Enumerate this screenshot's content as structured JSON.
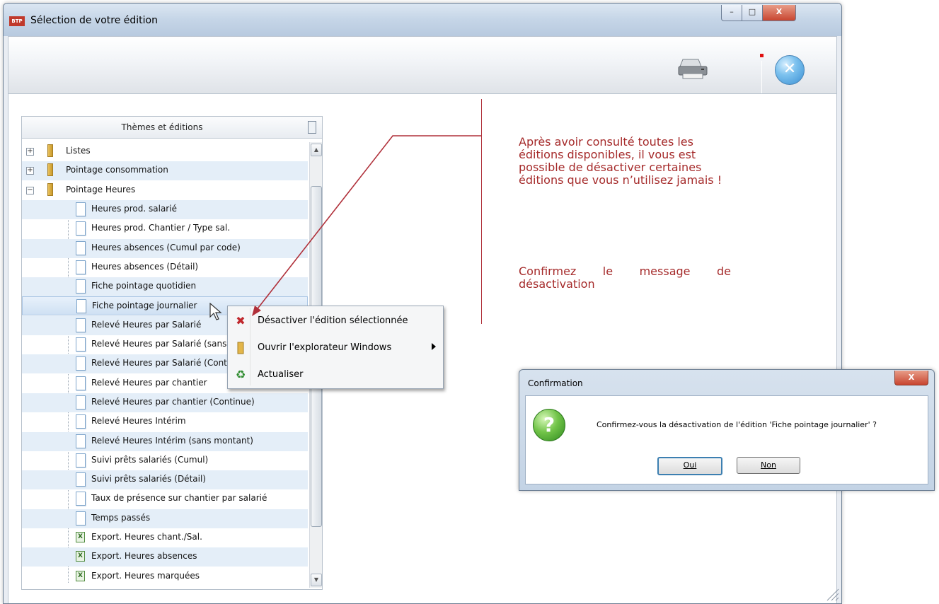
{
  "window": {
    "title": "Sélection de votre édition",
    "logo_text": "BTP",
    "controls": {
      "minimize": "–",
      "maximize": "□",
      "close": "X"
    }
  },
  "toolbar": {
    "print_icon": "printer-icon",
    "exit_icon": "exit-icon",
    "exit_glyph": "✕"
  },
  "tree": {
    "header": "Thèmes et éditions",
    "rows": [
      {
        "label": "Listes",
        "type": "folder",
        "expander": "+"
      },
      {
        "label": "Pointage consommation",
        "type": "folder",
        "expander": "+"
      },
      {
        "label": "Pointage Heures",
        "type": "folder",
        "expander": "−"
      },
      {
        "label": "Heures prod. salarié",
        "type": "doc"
      },
      {
        "label": "Heures prod. Chantier / Type sal.",
        "type": "doc"
      },
      {
        "label": "Heures absences (Cumul par code)",
        "type": "doc"
      },
      {
        "label": "Heures absences (Détail)",
        "type": "doc"
      },
      {
        "label": "Fiche pointage quotidien",
        "type": "doc"
      },
      {
        "label": "Fiche pointage journalier",
        "type": "doc",
        "selected": true
      },
      {
        "label": "Relevé Heures par Salarié",
        "type": "doc"
      },
      {
        "label": "Relevé Heures par Salarié (sans montant)",
        "type": "doc"
      },
      {
        "label": "Relevé Heures par Salarié (Continue)",
        "type": "doc"
      },
      {
        "label": "Relevé Heures par chantier",
        "type": "doc"
      },
      {
        "label": "Relevé Heures par chantier (Continue)",
        "type": "doc"
      },
      {
        "label": "Relevé Heures Intérim",
        "type": "doc"
      },
      {
        "label": "Relevé Heures Intérim (sans montant)",
        "type": "doc"
      },
      {
        "label": "Suivi prêts salariés (Cumul)",
        "type": "doc"
      },
      {
        "label": "Suivi prêts salariés (Détail)",
        "type": "doc"
      },
      {
        "label": "Taux de présence sur chantier par salarié",
        "type": "doc"
      },
      {
        "label": "Temps passés",
        "type": "doc"
      },
      {
        "label": "Export. Heures chant./Sal.",
        "type": "excel"
      },
      {
        "label": "Export. Heures absences",
        "type": "excel"
      },
      {
        "label": "Export. Heures marquées",
        "type": "excel"
      }
    ],
    "scroll_up": "▲",
    "scroll_down": "▼"
  },
  "context_menu": {
    "items": [
      {
        "label": "Désactiver l'édition sélectionnée",
        "icon": "delete-x-icon",
        "glyph": "✖"
      },
      {
        "label": "Ouvrir l'explorateur Windows",
        "icon": "folder-icon",
        "glyph": "",
        "has_submenu": true
      },
      {
        "label": "Actualiser",
        "icon": "refresh-icon",
        "glyph": "♻"
      }
    ]
  },
  "annotation": {
    "paragraph1": "Après avoir consulté toutes les éditions disponibles, il vous est possible de désactiver certaines éditions que vous n’utilisez jamais !",
    "paragraph2": "Confirmez le message de désactivation",
    "color": "#a52a2a"
  },
  "dialog": {
    "title": "Confirmation",
    "close": "X",
    "icon_glyph": "?",
    "message": "Confirmez-vous la désactivation de l'édition 'Fiche pointage journalier' ?",
    "yes": "Oui",
    "no": "Non"
  }
}
